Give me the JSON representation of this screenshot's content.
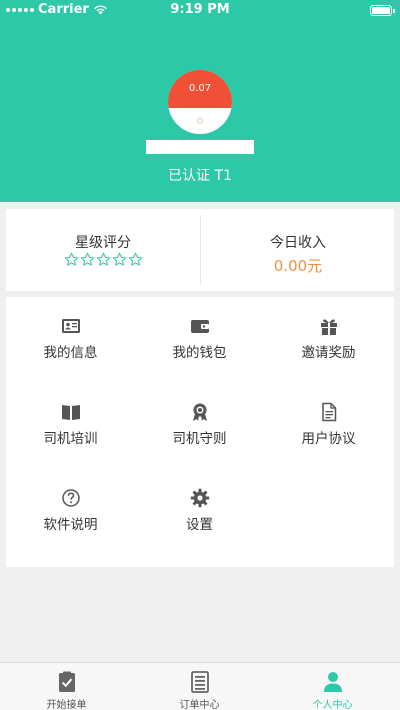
{
  "status_bar": {
    "carrier": "Carrier",
    "time": "9:19 PM"
  },
  "profile": {
    "avatar_value": "0.07",
    "verify_text": "已认证 T1",
    "header_color": "#2cc8a7"
  },
  "stats": {
    "rating_label": "星级评分",
    "rating_stars": 0,
    "rating_max": 5,
    "income_label": "今日收入",
    "income_value": "0.00元",
    "income_color": "#f19140"
  },
  "menu": {
    "items": [
      {
        "label": "我的信息",
        "icon": "id-card-icon"
      },
      {
        "label": "我的钱包",
        "icon": "wallet-icon"
      },
      {
        "label": "邀请奖励",
        "icon": "gift-icon"
      },
      {
        "label": "司机培训",
        "icon": "book-icon"
      },
      {
        "label": "司机守则",
        "icon": "award-icon"
      },
      {
        "label": "用户协议",
        "icon": "document-icon"
      },
      {
        "label": "软件说明",
        "icon": "help-icon"
      },
      {
        "label": "设置",
        "icon": "gear-icon"
      }
    ]
  },
  "tabbar": {
    "items": [
      {
        "label": "开始接单",
        "icon": "checklist-icon",
        "active": false
      },
      {
        "label": "订单中心",
        "icon": "list-icon",
        "active": false
      },
      {
        "label": "个人中心",
        "icon": "person-icon",
        "active": true
      }
    ]
  }
}
